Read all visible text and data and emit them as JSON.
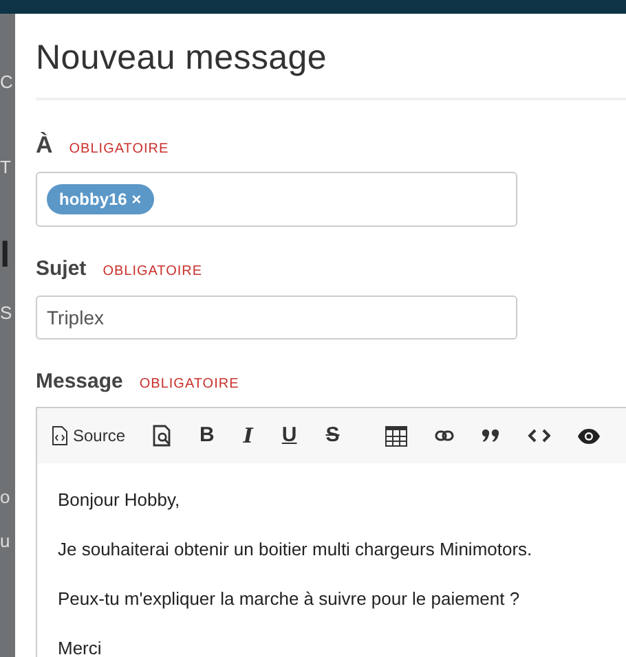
{
  "background_fragments": [
    {
      "text": "C"
    },
    {
      "text": "T"
    },
    {
      "text": "l",
      "kind": "heading"
    },
    {
      "text": "S"
    },
    {
      "text": "o"
    },
    {
      "text": "u"
    }
  ],
  "dialog": {
    "title": "Nouveau message",
    "fields": [
      {
        "kind": "tags",
        "label": "À",
        "required": "OBLIGATOIRE",
        "tags": [
          "hobby16 ×"
        ]
      },
      {
        "kind": "text",
        "label": "Sujet",
        "required": "OBLIGATOIRE",
        "value": "Triplex"
      },
      {
        "kind": "editor",
        "label": "Message",
        "required": "OBLIGATOIRE",
        "toolbar": [
          {
            "kind": "source",
            "label": "Source"
          },
          {
            "kind": "preview"
          },
          {
            "kind": "bold",
            "label": "B"
          },
          {
            "kind": "italic",
            "label": "I"
          },
          {
            "kind": "underline",
            "label": "U"
          },
          {
            "kind": "strike",
            "label": "S"
          },
          {
            "kind": "separator"
          },
          {
            "kind": "table"
          },
          {
            "kind": "link"
          },
          {
            "kind": "quote"
          },
          {
            "kind": "code"
          },
          {
            "kind": "eye"
          }
        ],
        "paragraphs": [
          "Bonjour Hobby,",
          "Je souhaiterai obtenir un boitier multi chargeurs Minimotors.",
          "Peux-tu m'expliquer la marche à suivre pour le paiement ?",
          "Merci"
        ]
      }
    ]
  }
}
